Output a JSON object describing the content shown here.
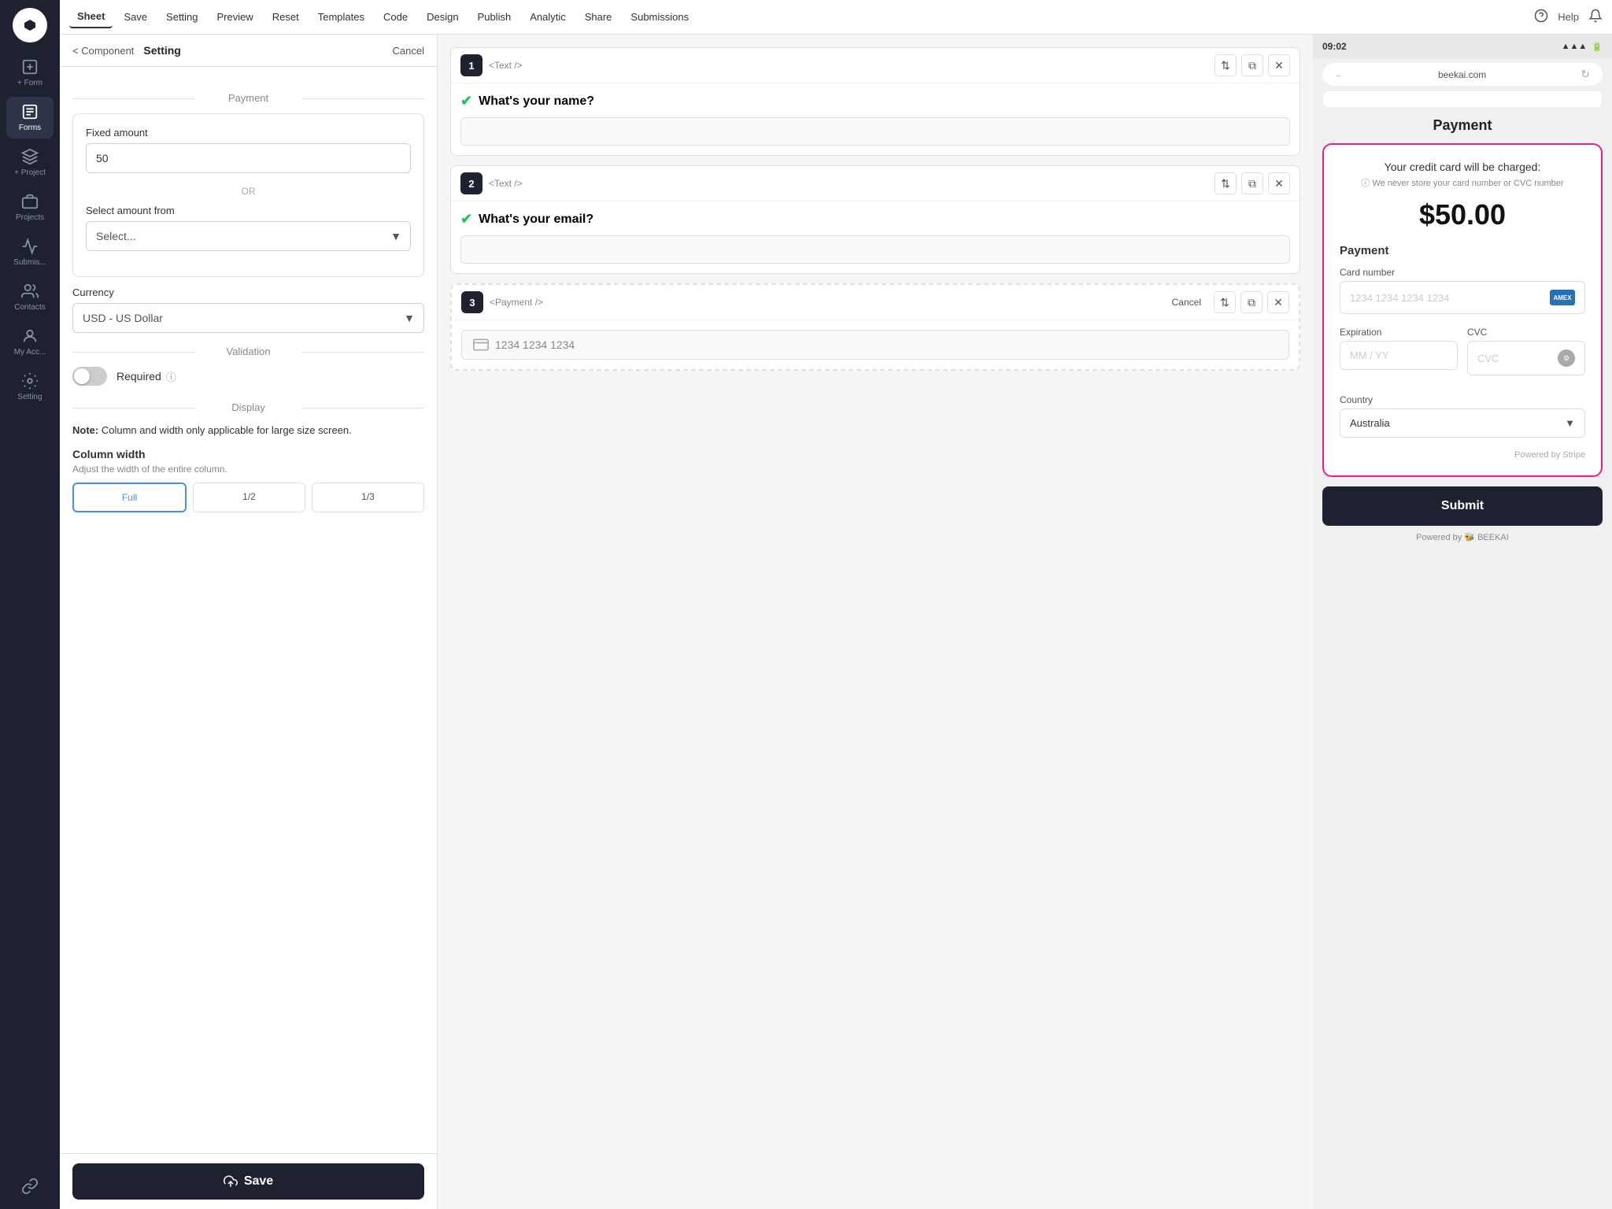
{
  "app": {
    "logo": "⬡",
    "title": "Beekai"
  },
  "sidebar": {
    "items": [
      {
        "id": "new-form",
        "label": "+ Form",
        "icon": "form"
      },
      {
        "id": "forms",
        "label": "Forms",
        "icon": "forms",
        "active": true
      },
      {
        "id": "new-project",
        "label": "+ Project",
        "icon": "project"
      },
      {
        "id": "projects",
        "label": "Projects",
        "icon": "projects"
      },
      {
        "id": "submissions",
        "label": "Submis...",
        "icon": "submissions"
      },
      {
        "id": "contacts",
        "label": "Contacts",
        "icon": "contacts"
      },
      {
        "id": "my-account",
        "label": "My Acc...",
        "icon": "account"
      },
      {
        "id": "setting",
        "label": "Setting",
        "icon": "setting"
      },
      {
        "id": "integrations",
        "label": "",
        "icon": "integrations"
      }
    ]
  },
  "topnav": {
    "items": [
      {
        "id": "sheet",
        "label": "Sheet",
        "active": true
      },
      {
        "id": "save",
        "label": "Save"
      },
      {
        "id": "setting",
        "label": "Setting"
      },
      {
        "id": "preview",
        "label": "Preview"
      },
      {
        "id": "reset",
        "label": "Reset"
      },
      {
        "id": "templates",
        "label": "Templates"
      },
      {
        "id": "code",
        "label": "Code"
      },
      {
        "id": "design",
        "label": "Design"
      },
      {
        "id": "publish",
        "label": "Publish"
      },
      {
        "id": "analytic",
        "label": "Analytic"
      },
      {
        "id": "share",
        "label": "Share"
      },
      {
        "id": "submissions",
        "label": "Submissions"
      }
    ],
    "help": "Help",
    "notification_icon": "bell"
  },
  "left_panel": {
    "back_label": "< Component",
    "title": "Setting",
    "cancel_label": "Cancel",
    "payment_section": "Payment",
    "fixed_amount_label": "Fixed amount",
    "fixed_amount_value": "50",
    "or_label": "OR",
    "select_amount_label": "Select amount from",
    "select_placeholder": "Select...",
    "currency_label": "Currency",
    "currency_value": "USD - US Dollar",
    "validation_section": "Validation",
    "required_label": "Required",
    "required_info": "ℹ",
    "display_section": "Display",
    "note_text_bold": "Note:",
    "note_text": " Column and width only applicable for large size screen.",
    "col_width_title": "Column width",
    "col_width_sub": "Adjust the width of the entire column.",
    "save_label": "Save",
    "save_icon": "↑"
  },
  "middle_panel": {
    "cards": [
      {
        "number": "1",
        "tag": "<Text />",
        "question": "What's your name?",
        "input_placeholder": ""
      },
      {
        "number": "2",
        "tag": "<Text />",
        "question": "What's your email?",
        "input_placeholder": ""
      },
      {
        "number": "3",
        "tag": "<Payment />",
        "card_number_placeholder": "1234 1234 1234",
        "cancel_label": "Cancel"
      }
    ]
  },
  "right_panel": {
    "status_time": "09:02",
    "url": "beekai.com",
    "page_title": "Payment",
    "charge_text": "Your credit card will be charged:",
    "charge_subtext": "ⓘ We never store your card number or CVC number",
    "charge_amount": "$50.00",
    "payment_section": "Payment",
    "card_number_label": "Card number",
    "card_number_placeholder": "1234 1234 1234 1234",
    "expiration_label": "Expiration",
    "expiration_placeholder": "MM / YY",
    "cvc_label": "CVC",
    "cvc_placeholder": "CVC",
    "country_label": "Country",
    "country_value": "Australia",
    "powered_stripe": "Powered by Stripe",
    "submit_label": "Submit",
    "powered_beekai": "Powered by  🐝 BEEKAI"
  }
}
